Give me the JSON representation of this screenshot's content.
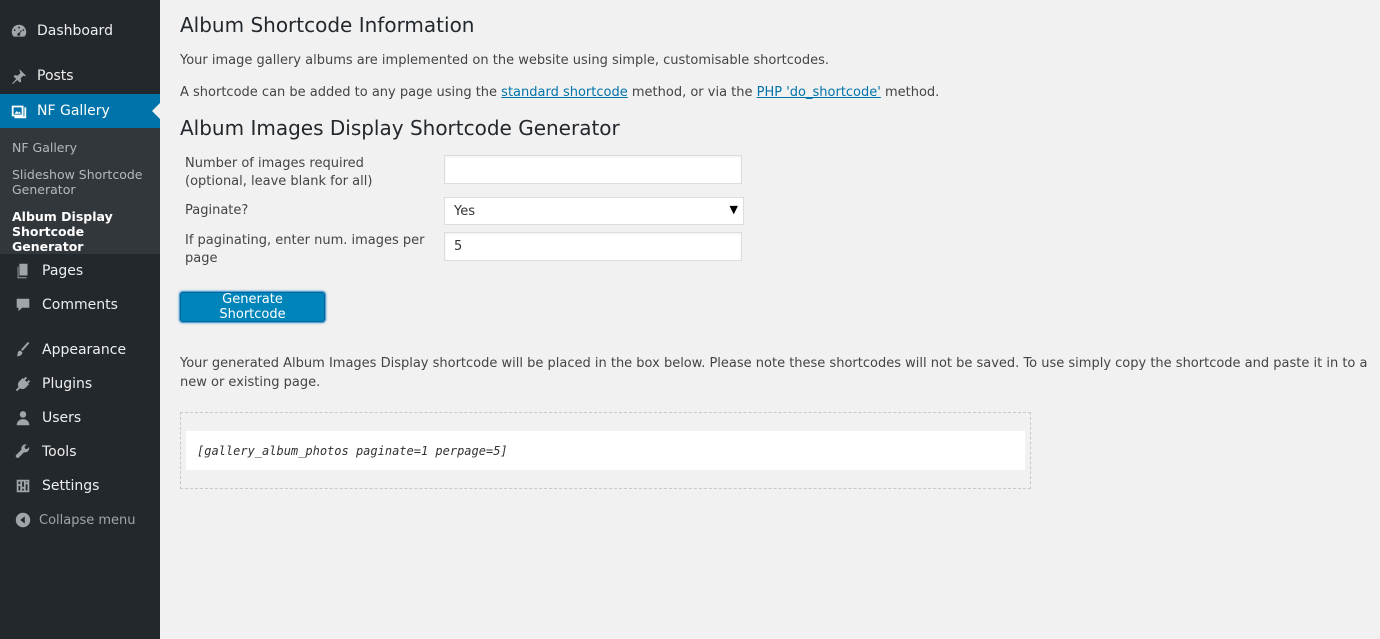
{
  "sidebar": {
    "top_items": [
      {
        "label": "Dashboard",
        "icon": "dashboard-icon"
      },
      {
        "label": "Posts",
        "icon": "pushpin-icon"
      },
      {
        "label": "NF Gallery",
        "icon": "gallery-icon"
      }
    ],
    "submenu": [
      {
        "label": "NF Gallery"
      },
      {
        "label": "Slideshow Shortcode Generator"
      },
      {
        "label": "Album Display Shortcode Generator"
      }
    ],
    "bottom_items": [
      {
        "label": "Pages",
        "icon": "pages-icon"
      },
      {
        "label": "Comments",
        "icon": "comment-icon"
      },
      {
        "label": "Appearance",
        "icon": "paintbrush-icon"
      },
      {
        "label": "Plugins",
        "icon": "plugin-icon"
      },
      {
        "label": "Users",
        "icon": "user-icon"
      },
      {
        "label": "Tools",
        "icon": "wrench-icon"
      },
      {
        "label": "Settings",
        "icon": "settings-icon"
      }
    ],
    "collapse_label": "Collapse menu"
  },
  "info": {
    "title": "Album Shortcode Information",
    "intro": "Your image gallery albums are implemented on the website using simple, customisable shortcodes.",
    "line2_prefix": "A shortcode can be added to any page using the ",
    "link1": "standard shortcode",
    "line2_middle": " method, or via the ",
    "link2": "PHP 'do_shortcode'",
    "line2_suffix": " method."
  },
  "generator": {
    "title": "Album Images Display Shortcode Generator",
    "num_images_label": "Number of images required (optional, leave blank for all)",
    "num_images_value": "",
    "paginate_label": "Paginate?",
    "paginate_value": "Yes",
    "per_page_label": "If paginating, enter num. images per page",
    "per_page_value": "5",
    "button_label": "Generate Shortcode"
  },
  "result": {
    "note": "Your generated Album Images Display shortcode will be placed in the box below. Please note these shortcodes will not be saved. To use simply copy the shortcode and paste it in to a new or existing page.",
    "shortcode": "[gallery_album_photos paginate=1 perpage=5]"
  },
  "colors": {
    "sidebar_bg": "#23282d",
    "submenu_bg": "#32373c",
    "accent": "#0073aa",
    "button": "#0085ba",
    "page_bg": "#f1f1f1"
  }
}
